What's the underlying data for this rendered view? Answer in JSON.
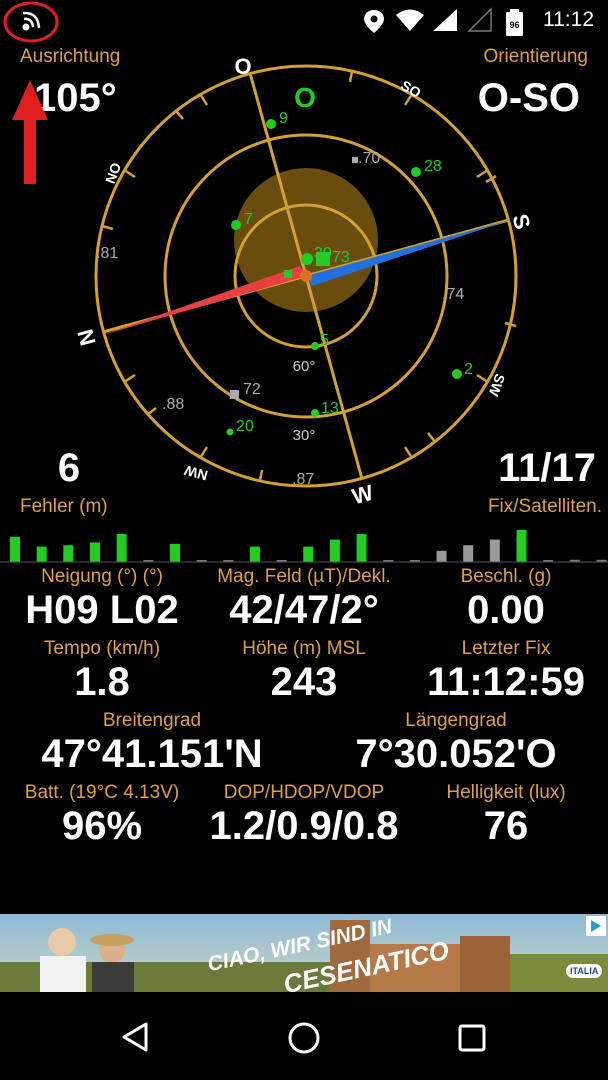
{
  "status": {
    "time": "11:12",
    "battery_level": "96"
  },
  "compass": {
    "left_top_label": "Ausrichtung",
    "heading": "105°",
    "right_top_label": "Orientierung",
    "direction": "O-SO",
    "error_value": "6",
    "error_label": "Fehler (m)",
    "fix_value": "11/17",
    "fix_label": "Fix/Satelliten.",
    "cardinals": {
      "north": "N",
      "east": "O",
      "south": "S",
      "west": "W",
      "ne": "NO",
      "se": "SO",
      "sw": "SW",
      "nw": "NW"
    },
    "ring_labels": {
      "r60": "60°",
      "r30": "30°"
    },
    "markers": {
      "o_letter": "O",
      "sat9": "9",
      "sat28": "28",
      "sat70": ".70",
      "sat7": "7",
      "sat81": ".81",
      "sat30": "30",
      "sat73": "73",
      "sat74": ".74",
      "sat5": "5",
      "sat2": "2",
      "sat72": "72",
      "sat88": ".88",
      "sat13": "13",
      "sat20": "20",
      "sat87": ".87"
    }
  },
  "signal_bars": [
    {
      "value": 0.9,
      "color": "#22cc22"
    },
    {
      "value": 0.55,
      "color": "#22cc22"
    },
    {
      "value": 0.6,
      "color": "#22cc22"
    },
    {
      "value": 0.7,
      "color": "#22cc22"
    },
    {
      "value": 1.0,
      "color": "#22cc22"
    },
    {
      "value": 0.05,
      "color": "#777"
    },
    {
      "value": 0.65,
      "color": "#22cc22"
    },
    {
      "value": 0.05,
      "color": "#777"
    },
    {
      "value": 0.05,
      "color": "#777"
    },
    {
      "value": 0.55,
      "color": "#22cc22"
    },
    {
      "value": 0.05,
      "color": "#777"
    },
    {
      "value": 0.55,
      "color": "#22cc22"
    },
    {
      "value": 0.8,
      "color": "#22cc22"
    },
    {
      "value": 1.0,
      "color": "#22cc22"
    },
    {
      "value": 0.05,
      "color": "#777"
    },
    {
      "value": 0.05,
      "color": "#777"
    },
    {
      "value": 0.4,
      "color": "#999"
    },
    {
      "value": 0.6,
      "color": "#999"
    },
    {
      "value": 0.8,
      "color": "#999"
    },
    {
      "value": 1.15,
      "color": "#22cc22"
    },
    {
      "value": 0.05,
      "color": "#777"
    },
    {
      "value": 0.08,
      "color": "#777"
    },
    {
      "value": 0.08,
      "color": "#777"
    }
  ],
  "metrics": [
    {
      "label": "Neigung (°) (°)",
      "value": "H09 L02"
    },
    {
      "label": "Mag. Feld (µT)/Dekl.",
      "value": "42/47/2°"
    },
    {
      "label": "Beschl. (g)",
      "value": "0.00"
    },
    {
      "label": "Tempo (km/h)",
      "value": "1.8"
    },
    {
      "label": "Höhe (m) MSL",
      "value": "243"
    },
    {
      "label": "Letzter Fix",
      "value": "11:12:59"
    },
    {
      "label": "Breitengrad",
      "value": "47°41.151'N"
    },
    {
      "label": "Längengrad",
      "value": "7°30.052'O"
    },
    {
      "label": "Batt. (19°C 4.13V)",
      "value": "96%"
    },
    {
      "label": "DOP/HDOP/VDOP",
      "value": "1.2/0.9/0.8"
    },
    {
      "label": "Helligkeit (lux)",
      "value": "76"
    }
  ],
  "ad": {
    "headline": "CIAO, WIR SIND IN",
    "place": "CESENATICO",
    "brand": "ITALIA"
  },
  "colors": {
    "accent": "#e0a040",
    "ring": "#d4a030",
    "green": "#22cc22"
  }
}
